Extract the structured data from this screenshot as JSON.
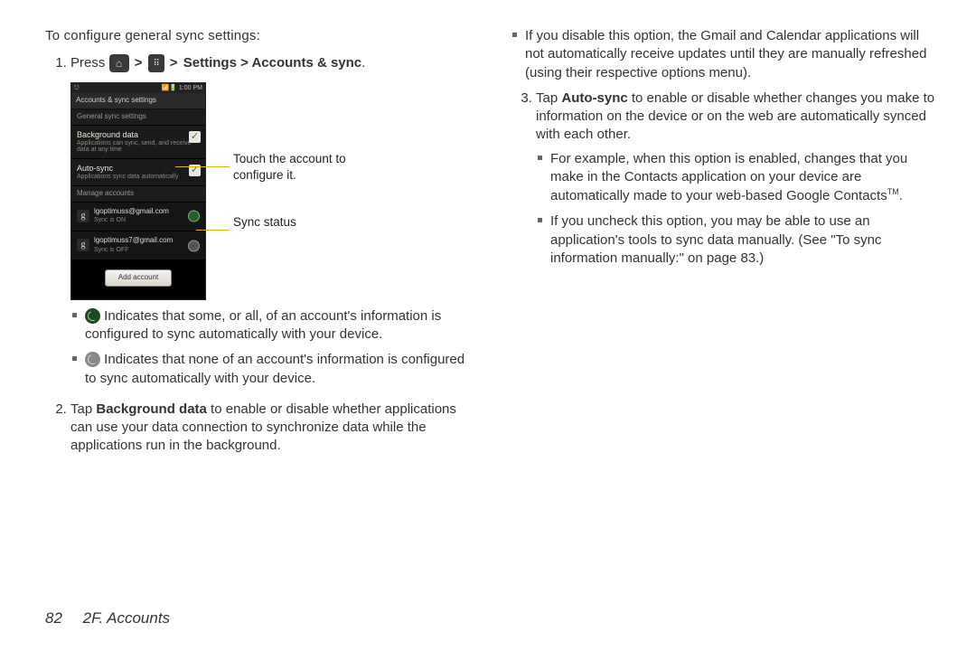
{
  "intro": "To configure general sync settings:",
  "step1": {
    "press": "Press",
    "separator": ">",
    "path_bold": "Settings > Accounts & sync",
    "period": "."
  },
  "phone": {
    "statusbar_left": "⎋",
    "statusbar_right": "📶🔋 1:00 PM",
    "title": "Accounts & sync settings",
    "section_general": "General sync settings",
    "bg_data_title": "Background data",
    "bg_data_desc": "Applications can sync, send, and receive data at any time",
    "autosync_title": "Auto-sync",
    "autosync_desc": "Applications sync data automatically",
    "section_manage": "Manage accounts",
    "accounts": [
      {
        "email": "lgoptimuss@gmail.com",
        "status": "Sync is ON",
        "synced": true
      },
      {
        "email": "lgoptimuss7@gmail.com",
        "status": "Sync is OFF",
        "synced": false
      }
    ],
    "add_account": "Add account"
  },
  "callouts": {
    "configure": "Touch the account to configure it.",
    "sync_status": "Sync status"
  },
  "bullets_after_phone": {
    "b1": "Indicates that some, or all, of an account's information is configured to sync automatically with your device.",
    "b2": "Indicates that none of an account's information is configured to sync automatically with your device."
  },
  "step2": {
    "prefix": "Tap ",
    "bold": "Background data",
    "rest": " to enable or disable whether applications can use your data connection to synchronize data while the applications run in the background."
  },
  "col2": {
    "disable_note": "If you disable this option, the Gmail and Calendar applications will not automatically receive updates until they are manually refreshed (using their respective options menu).",
    "step3_prefix": "Tap ",
    "step3_bold": "Auto-sync",
    "step3_rest": " to enable or disable whether changes you make to information on the device or on the web are automatically synced with each other.",
    "example": "For example, when this option is enabled, changes that you make in the Contacts application on your device are automatically made to your web-based Google Contacts",
    "tm": "TM",
    "example_end": ".",
    "uncheck": "If you uncheck this option, you may be able to use an application's tools to sync data manually. (See \"To sync information manually:\" on page 83.)"
  },
  "footer": {
    "page_num": "82",
    "section": "2F. Accounts"
  }
}
